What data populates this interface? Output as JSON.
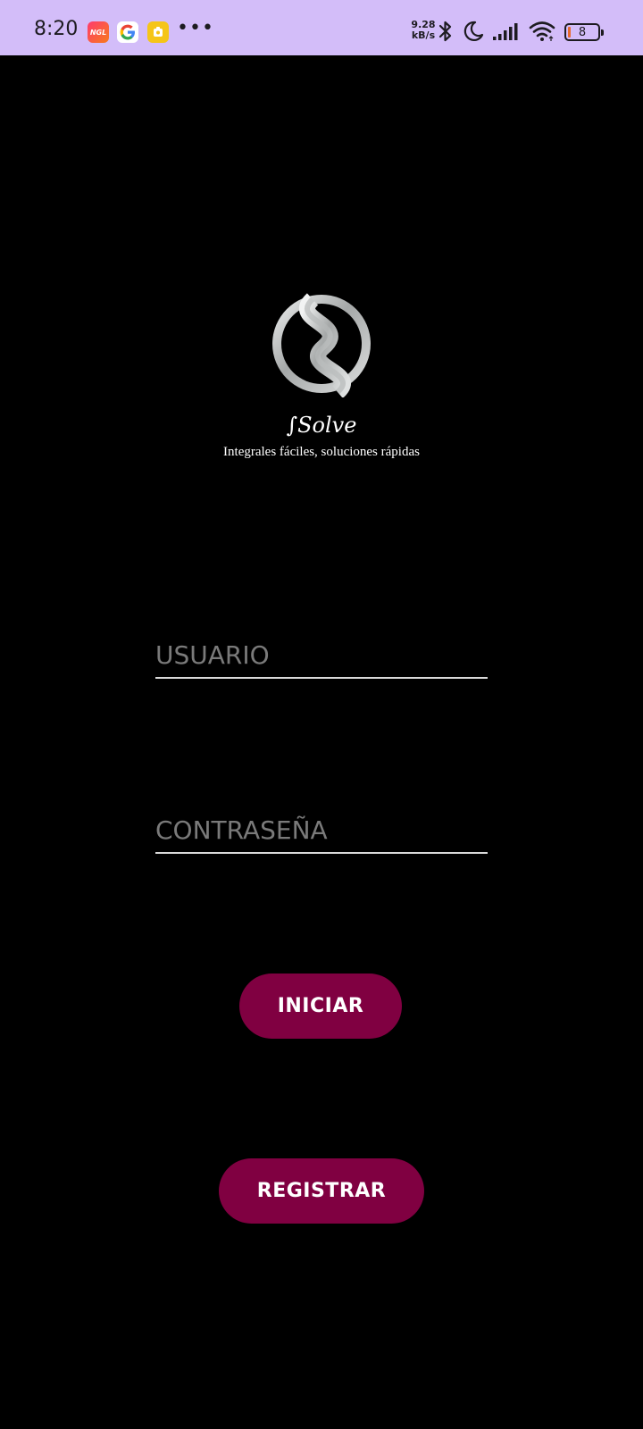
{
  "status_bar": {
    "time": "8:20",
    "app_icons": [
      "ngl-app-icon",
      "google-icon",
      "yellow-app-icon"
    ],
    "ngl_label": "NGL",
    "google_label": "G",
    "more": "•••",
    "speed_value": "9.28",
    "speed_unit": "kB/s",
    "indicators": [
      "bluetooth-icon",
      "moon-icon",
      "signal-icon",
      "wifi-icon"
    ],
    "battery_level": "8",
    "battery_color": "#e8692c",
    "background_color": "#d3bdf9"
  },
  "brand": {
    "name": "∫Solve",
    "tagline": "Integrales fáciles, soluciones rápidas",
    "logo_icon": "s-logo-icon"
  },
  "form": {
    "user_placeholder": "USUARIO",
    "password_placeholder": "CONTRASEÑA",
    "login_label": "INICIAR",
    "register_label": "REGISTRAR"
  },
  "colors": {
    "background": "#000000",
    "button": "#800041",
    "placeholder": "#7a7a7a"
  }
}
